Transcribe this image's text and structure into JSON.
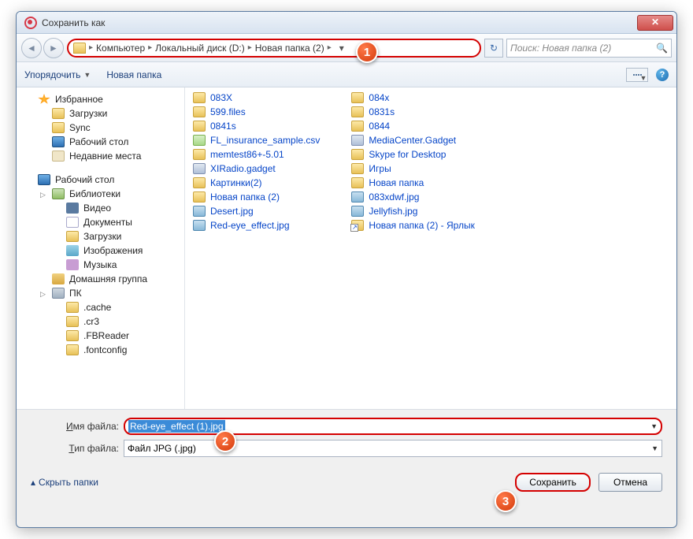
{
  "window": {
    "title": "Сохранить как",
    "close": "✕"
  },
  "nav": {
    "breadcrumb": [
      "Компьютер",
      "Локальный диск (D:)",
      "Новая папка (2)"
    ],
    "search_placeholder": "Поиск: Новая папка (2)"
  },
  "toolbar": {
    "organize": "Упорядочить",
    "new_folder": "Новая папка"
  },
  "sidebar": {
    "groups": [
      {
        "label": "Избранное",
        "icon": "star",
        "children": [
          {
            "label": "Загрузки",
            "icon": "folder"
          },
          {
            "label": "Sync",
            "icon": "sync"
          },
          {
            "label": "Рабочий стол",
            "icon": "desktop"
          },
          {
            "label": "Недавние места",
            "icon": "recent"
          }
        ]
      },
      {
        "label": "Рабочий стол",
        "icon": "desktop",
        "children": [
          {
            "label": "Библиотеки",
            "icon": "lib",
            "children": [
              {
                "label": "Видео",
                "icon": "video"
              },
              {
                "label": "Документы",
                "icon": "doc"
              },
              {
                "label": "Загрузки",
                "icon": "folder"
              },
              {
                "label": "Изображения",
                "icon": "img"
              },
              {
                "label": "Музыка",
                "icon": "music"
              }
            ]
          },
          {
            "label": "Домашняя группа",
            "icon": "home"
          },
          {
            "label": "ПК",
            "icon": "pc",
            "children": [
              {
                "label": ".cache",
                "icon": "folder"
              },
              {
                "label": ".cr3",
                "icon": "folder"
              },
              {
                "label": ".FBReader",
                "icon": "folder"
              },
              {
                "label": ".fontconfig",
                "icon": "folder"
              }
            ]
          }
        ]
      }
    ]
  },
  "files": {
    "col1": [
      {
        "name": "083X",
        "icon": "folder"
      },
      {
        "name": "599.files",
        "icon": "folder"
      },
      {
        "name": "0841s",
        "icon": "folder"
      },
      {
        "name": "FL_insurance_sample.csv",
        "icon": "csv"
      },
      {
        "name": "memtest86+-5.01",
        "icon": "folder"
      },
      {
        "name": "XIRadio.gadget",
        "icon": "gadget"
      },
      {
        "name": "Картинки(2)",
        "icon": "folder"
      },
      {
        "name": "Новая папка (2)",
        "icon": "folder"
      },
      {
        "name": "Desert.jpg",
        "icon": "jpg"
      },
      {
        "name": "Red-eye_effect.jpg",
        "icon": "jpg"
      }
    ],
    "col2": [
      {
        "name": "084x",
        "icon": "folder"
      },
      {
        "name": "0831s",
        "icon": "folder"
      },
      {
        "name": "0844",
        "icon": "folder"
      },
      {
        "name": "MediaCenter.Gadget",
        "icon": "gadget"
      },
      {
        "name": "Skype for Desktop",
        "icon": "folder"
      },
      {
        "name": "Игры",
        "icon": "folder"
      },
      {
        "name": "Новая папка",
        "icon": "folder"
      },
      {
        "name": "083xdwf.jpg",
        "icon": "jpg"
      },
      {
        "name": "Jellyfish.jpg",
        "icon": "jpg"
      },
      {
        "name": "Новая папка (2) - Ярлык",
        "icon": "link"
      }
    ]
  },
  "inputs": {
    "filename_label": "Имя файла:",
    "filename_value": "Red-eye_effect (1).jpg",
    "filetype_label": "Тип файла:",
    "filetype_value": "Файл JPG (.jpg)"
  },
  "footer": {
    "hide_folders": "Скрыть папки",
    "save": "Сохранить",
    "cancel": "Отмена"
  },
  "callouts": {
    "c1": "1",
    "c2": "2",
    "c3": "3"
  }
}
